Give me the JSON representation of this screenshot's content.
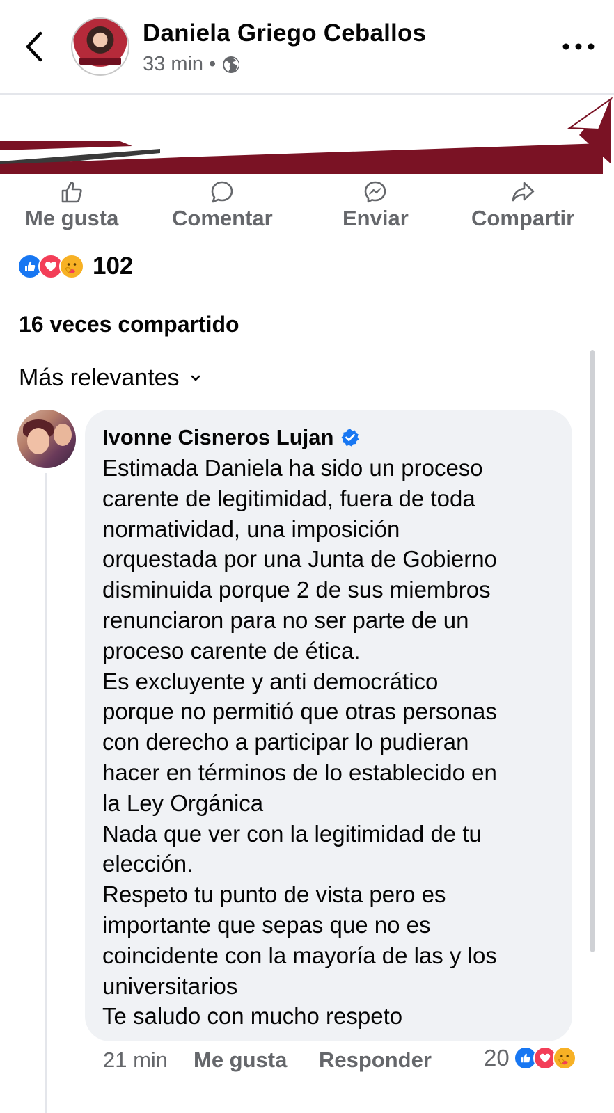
{
  "header": {
    "author": "Daniela Griego Ceballos",
    "time": "33 min",
    "separator": "•",
    "privacy_icon": "globe-icon",
    "back_icon": "chevron-left-icon",
    "more_icon": "more-dots-icon"
  },
  "actions": [
    {
      "label": "Me gusta",
      "icon": "thumbs-up-icon"
    },
    {
      "label": "Comentar",
      "icon": "comment-icon"
    },
    {
      "label": "Enviar",
      "icon": "messenger-icon"
    },
    {
      "label": "Compartir",
      "icon": "share-icon"
    }
  ],
  "reactions": {
    "count": "102",
    "types": [
      "like",
      "love",
      "care"
    ]
  },
  "shares": "16 veces compartido",
  "sort": {
    "label": "Más relevantes",
    "icon": "chevron-down-icon"
  },
  "comment": {
    "author": "Ivonne Cisneros Lujan",
    "verified": true,
    "lines": [
      "Estimada Daniela ha sido un proceso",
      "carente de legitimidad, fuera de toda",
      "normatividad, una imposición",
      "orquestada por una Junta de Gobierno",
      "disminuida porque 2 de sus miembros",
      "renunciaron para no ser parte de un",
      "proceso carente de ética.",
      "Es excluyente y anti democrático",
      "porque no permitió que otras personas",
      "con derecho a participar lo pudieran",
      "hacer en términos de lo establecido en",
      "la Ley Orgánica",
      "Nada que ver con la legitimidad de tu",
      "elección.",
      "Respeto tu punto de vista pero es",
      "importante que sepas que no es",
      "coincidente con la mayoría de las y los",
      "universitarios",
      "Te saludo con mucho respeto"
    ],
    "time": "21 min",
    "like_label": "Me gusta",
    "reply_label": "Responder",
    "reaction_count": "20"
  },
  "colors": {
    "brand_blue": "#1877f2",
    "love_red": "#f33e58",
    "care_yellow": "#f7b125",
    "banner_maroon": "#7a1224",
    "muted_text": "#65676b",
    "bubble_bg": "#f0f2f5"
  }
}
